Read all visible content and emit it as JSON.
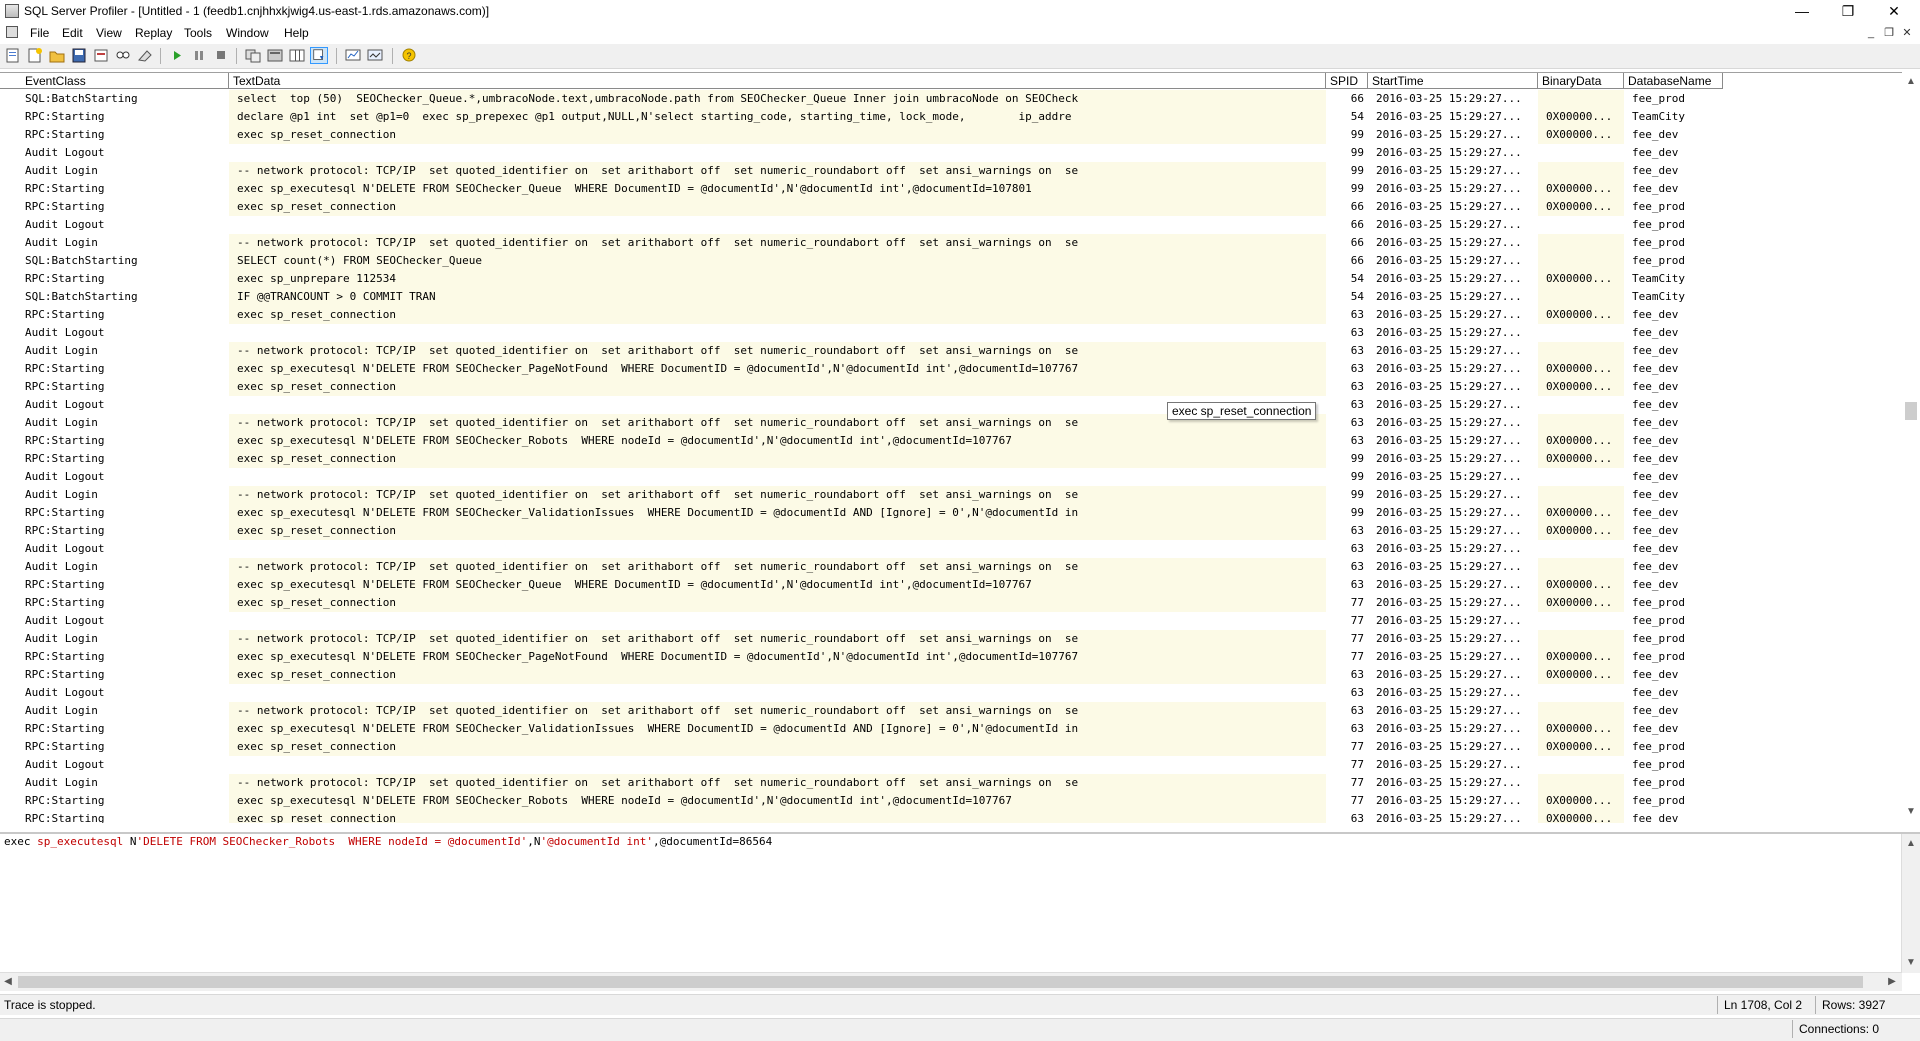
{
  "window": {
    "title": "SQL Server Profiler - [Untitled - 1 (feedb1.cnjhhxkjwig4.us-east-1.rds.amazonaws.com)]",
    "controls": {
      "minimize": "—",
      "restore": "❐",
      "close": "✕"
    }
  },
  "menu": [
    "File",
    "Edit",
    "View",
    "Replay",
    "Tools",
    "Window",
    "Help"
  ],
  "mdi_controls": {
    "minimize": "_",
    "restore": "❐",
    "close": "✕"
  },
  "columns": [
    "EventClass",
    "TextData",
    "SPID",
    "StartTime",
    "BinaryData",
    "DatabaseName"
  ],
  "rows": [
    {
      "event": "SQL:BatchStarting",
      "text": "select  top (50)  SEOChecker_Queue.*,umbracoNode.text,umbracoNode.path from SEOChecker_Queue Inner join umbracoNode on SEOCheck",
      "spid": "66",
      "start": "2016-03-25 15:29:27...",
      "bin": "",
      "db": "fee_prod"
    },
    {
      "event": "RPC:Starting",
      "text": "declare @p1 int  set @p1=0  exec sp_prepexec @p1 output,NULL,N'select starting_code, starting_time, lock_mode,        ip_addre",
      "spid": "54",
      "start": "2016-03-25 15:29:27...",
      "bin": "0X00000...",
      "db": "TeamCity"
    },
    {
      "event": "RPC:Starting",
      "text": "exec sp_reset_connection",
      "spid": "99",
      "start": "2016-03-25 15:29:27...",
      "bin": "0X00000...",
      "db": "fee_dev"
    },
    {
      "event": "Audit Logout",
      "text": "",
      "spid": "99",
      "start": "2016-03-25 15:29:27...",
      "bin": "",
      "db": "fee_dev"
    },
    {
      "event": "Audit Login",
      "text": "-- network protocol: TCP/IP  set quoted_identifier on  set arithabort off  set numeric_roundabort off  set ansi_warnings on  se",
      "spid": "99",
      "start": "2016-03-25 15:29:27...",
      "bin": "",
      "db": "fee_dev"
    },
    {
      "event": "RPC:Starting",
      "text": "exec sp_executesql N'DELETE FROM SEOChecker_Queue  WHERE DocumentID = @documentId',N'@documentId int',@documentId=107801",
      "spid": "99",
      "start": "2016-03-25 15:29:27...",
      "bin": "0X00000...",
      "db": "fee_dev"
    },
    {
      "event": "RPC:Starting",
      "text": "exec sp_reset_connection",
      "spid": "66",
      "start": "2016-03-25 15:29:27...",
      "bin": "0X00000...",
      "db": "fee_prod"
    },
    {
      "event": "Audit Logout",
      "text": "",
      "spid": "66",
      "start": "2016-03-25 15:29:27...",
      "bin": "",
      "db": "fee_prod"
    },
    {
      "event": "Audit Login",
      "text": "-- network protocol: TCP/IP  set quoted_identifier on  set arithabort off  set numeric_roundabort off  set ansi_warnings on  se",
      "spid": "66",
      "start": "2016-03-25 15:29:27...",
      "bin": "",
      "db": "fee_prod"
    },
    {
      "event": "SQL:BatchStarting",
      "text": "SELECT count(*) FROM SEOChecker_Queue",
      "spid": "66",
      "start": "2016-03-25 15:29:27...",
      "bin": "",
      "db": "fee_prod"
    },
    {
      "event": "RPC:Starting",
      "text": "exec sp_unprepare 112534",
      "spid": "54",
      "start": "2016-03-25 15:29:27...",
      "bin": "0X00000...",
      "db": "TeamCity"
    },
    {
      "event": "SQL:BatchStarting",
      "text": "IF @@TRANCOUNT > 0 COMMIT TRAN",
      "spid": "54",
      "start": "2016-03-25 15:29:27...",
      "bin": "",
      "db": "TeamCity"
    },
    {
      "event": "RPC:Starting",
      "text": "exec sp_reset_connection",
      "spid": "63",
      "start": "2016-03-25 15:29:27...",
      "bin": "0X00000...",
      "db": "fee_dev"
    },
    {
      "event": "Audit Logout",
      "text": "",
      "spid": "63",
      "start": "2016-03-25 15:29:27...",
      "bin": "",
      "db": "fee_dev"
    },
    {
      "event": "Audit Login",
      "text": "-- network protocol: TCP/IP  set quoted_identifier on  set arithabort off  set numeric_roundabort off  set ansi_warnings on  se",
      "spid": "63",
      "start": "2016-03-25 15:29:27...",
      "bin": "",
      "db": "fee_dev"
    },
    {
      "event": "RPC:Starting",
      "text": "exec sp_executesql N'DELETE FROM SEOChecker_PageNotFound  WHERE DocumentID = @documentId',N'@documentId int',@documentId=107767",
      "spid": "63",
      "start": "2016-03-25 15:29:27...",
      "bin": "0X00000...",
      "db": "fee_dev"
    },
    {
      "event": "RPC:Starting",
      "text": "exec sp_reset_connection",
      "spid": "63",
      "start": "2016-03-25 15:29:27...",
      "bin": "0X00000...",
      "db": "fee_dev"
    },
    {
      "event": "Audit Logout",
      "text": "",
      "spid": "63",
      "start": "2016-03-25 15:29:27...",
      "bin": "",
      "db": "fee_dev"
    },
    {
      "event": "Audit Login",
      "text": "-- network protocol: TCP/IP  set quoted_identifier on  set arithabort off  set numeric_roundabort off  set ansi_warnings on  se",
      "spid": "63",
      "start": "2016-03-25 15:29:27...",
      "bin": "",
      "db": "fee_dev"
    },
    {
      "event": "RPC:Starting",
      "text": "exec sp_executesql N'DELETE FROM SEOChecker_Robots  WHERE nodeId = @documentId',N'@documentId int',@documentId=107767",
      "spid": "63",
      "start": "2016-03-25 15:29:27...",
      "bin": "0X00000...",
      "db": "fee_dev"
    },
    {
      "event": "RPC:Starting",
      "text": "exec sp_reset_connection",
      "spid": "99",
      "start": "2016-03-25 15:29:27...",
      "bin": "0X00000...",
      "db": "fee_dev"
    },
    {
      "event": "Audit Logout",
      "text": "",
      "spid": "99",
      "start": "2016-03-25 15:29:27...",
      "bin": "",
      "db": "fee_dev"
    },
    {
      "event": "Audit Login",
      "text": "-- network protocol: TCP/IP  set quoted_identifier on  set arithabort off  set numeric_roundabort off  set ansi_warnings on  se",
      "spid": "99",
      "start": "2016-03-25 15:29:27...",
      "bin": "",
      "db": "fee_dev"
    },
    {
      "event": "RPC:Starting",
      "text": "exec sp_executesql N'DELETE FROM SEOChecker_ValidationIssues  WHERE DocumentID = @documentId AND [Ignore] = 0',N'@documentId in",
      "spid": "99",
      "start": "2016-03-25 15:29:27...",
      "bin": "0X00000...",
      "db": "fee_dev"
    },
    {
      "event": "RPC:Starting",
      "text": "exec sp_reset_connection",
      "spid": "63",
      "start": "2016-03-25 15:29:27...",
      "bin": "0X00000...",
      "db": "fee_dev"
    },
    {
      "event": "Audit Logout",
      "text": "",
      "spid": "63",
      "start": "2016-03-25 15:29:27...",
      "bin": "",
      "db": "fee_dev"
    },
    {
      "event": "Audit Login",
      "text": "-- network protocol: TCP/IP  set quoted_identifier on  set arithabort off  set numeric_roundabort off  set ansi_warnings on  se",
      "spid": "63",
      "start": "2016-03-25 15:29:27...",
      "bin": "",
      "db": "fee_dev"
    },
    {
      "event": "RPC:Starting",
      "text": "exec sp_executesql N'DELETE FROM SEOChecker_Queue  WHERE DocumentID = @documentId',N'@documentId int',@documentId=107767",
      "spid": "63",
      "start": "2016-03-25 15:29:27...",
      "bin": "0X00000...",
      "db": "fee_dev"
    },
    {
      "event": "RPC:Starting",
      "text": "exec sp_reset_connection",
      "spid": "77",
      "start": "2016-03-25 15:29:27...",
      "bin": "0X00000...",
      "db": "fee_prod"
    },
    {
      "event": "Audit Logout",
      "text": "",
      "spid": "77",
      "start": "2016-03-25 15:29:27...",
      "bin": "",
      "db": "fee_prod"
    },
    {
      "event": "Audit Login",
      "text": "-- network protocol: TCP/IP  set quoted_identifier on  set arithabort off  set numeric_roundabort off  set ansi_warnings on  se",
      "spid": "77",
      "start": "2016-03-25 15:29:27...",
      "bin": "",
      "db": "fee_prod"
    },
    {
      "event": "RPC:Starting",
      "text": "exec sp_executesql N'DELETE FROM SEOChecker_PageNotFound  WHERE DocumentID = @documentId',N'@documentId int',@documentId=107767",
      "spid": "77",
      "start": "2016-03-25 15:29:27...",
      "bin": "0X00000...",
      "db": "fee_prod"
    },
    {
      "event": "RPC:Starting",
      "text": "exec sp_reset_connection",
      "spid": "63",
      "start": "2016-03-25 15:29:27...",
      "bin": "0X00000...",
      "db": "fee_dev"
    },
    {
      "event": "Audit Logout",
      "text": "",
      "spid": "63",
      "start": "2016-03-25 15:29:27...",
      "bin": "",
      "db": "fee_dev"
    },
    {
      "event": "Audit Login",
      "text": "-- network protocol: TCP/IP  set quoted_identifier on  set arithabort off  set numeric_roundabort off  set ansi_warnings on  se",
      "spid": "63",
      "start": "2016-03-25 15:29:27...",
      "bin": "",
      "db": "fee_dev"
    },
    {
      "event": "RPC:Starting",
      "text": "exec sp_executesql N'DELETE FROM SEOChecker_ValidationIssues  WHERE DocumentID = @documentId AND [Ignore] = 0',N'@documentId in",
      "spid": "63",
      "start": "2016-03-25 15:29:27...",
      "bin": "0X00000...",
      "db": "fee_dev"
    },
    {
      "event": "RPC:Starting",
      "text": "exec sp_reset_connection",
      "spid": "77",
      "start": "2016-03-25 15:29:27...",
      "bin": "0X00000...",
      "db": "fee_prod"
    },
    {
      "event": "Audit Logout",
      "text": "",
      "spid": "77",
      "start": "2016-03-25 15:29:27...",
      "bin": "",
      "db": "fee_prod"
    },
    {
      "event": "Audit Login",
      "text": "-- network protocol: TCP/IP  set quoted_identifier on  set arithabort off  set numeric_roundabort off  set ansi_warnings on  se",
      "spid": "77",
      "start": "2016-03-25 15:29:27...",
      "bin": "",
      "db": "fee_prod"
    },
    {
      "event": "RPC:Starting",
      "text": "exec sp_executesql N'DELETE FROM SEOChecker_Robots  WHERE nodeId = @documentId',N'@documentId int',@documentId=107767",
      "spid": "77",
      "start": "2016-03-25 15:29:27...",
      "bin": "0X00000...",
      "db": "fee_prod"
    },
    {
      "event": "RPC:Starting",
      "text": "exec sp_reset_connection",
      "spid": "63",
      "start": "2016-03-25 15:29:27...",
      "bin": "0X00000...",
      "db": "fee_dev"
    }
  ],
  "tooltip": "exec sp_reset_connection",
  "detail": {
    "exec": "exec ",
    "proc": "sp_executesql ",
    "n1": "N",
    "q1": "'DELETE FROM SEOChecker_Robots  WHERE nodeId = @documentId'",
    "comma1": ",",
    "n2": "N",
    "q2": "'@documentId int'",
    "tail": ",@documentId=86564"
  },
  "status": {
    "message": "Trace is stopped.",
    "position": "Ln 1708, Col 2",
    "rows": "Rows: 3927",
    "connections": "Connections: 0"
  },
  "icons": [
    "new-trace-icon",
    "template-icon",
    "open-icon",
    "save-icon",
    "properties-icon",
    "find-icon",
    "clear-icon",
    "start-icon",
    "pause-icon",
    "stop-icon",
    "sql-icon",
    "perfmon-icon",
    "column-icon",
    "autoscroll-icon",
    "monitor-icon",
    "activity-icon",
    "help-icon"
  ]
}
